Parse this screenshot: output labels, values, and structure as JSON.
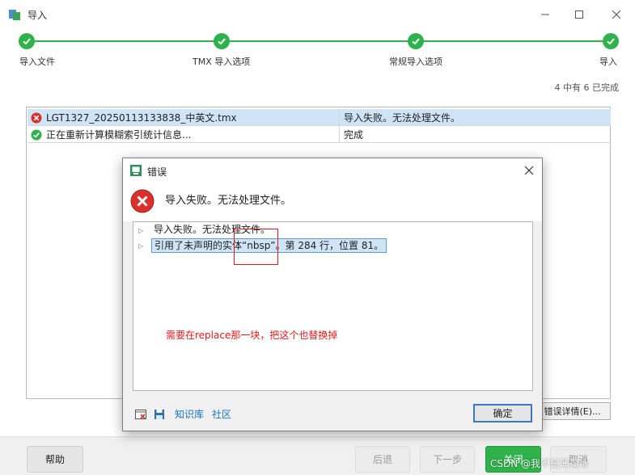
{
  "window": {
    "title": "导入",
    "icon": "app-import-icon",
    "controls": [
      "minimize-icon",
      "maximize-icon",
      "close-icon"
    ]
  },
  "steps": [
    {
      "label": "导入文件",
      "state": "complete"
    },
    {
      "label": "TMX 导入选项",
      "state": "complete"
    },
    {
      "label": "常规导入选项",
      "state": "complete"
    },
    {
      "label": "导入",
      "state": "complete"
    }
  ],
  "progress_text": "4 中有 6 已完成",
  "tasks": [
    {
      "name": "LGT1327_20250113133838_中英文.tmx",
      "status": "导入失败。无法处理文件。",
      "icon": "error-icon",
      "selected": true
    },
    {
      "name": "正在重新计算模糊索引统计信息...",
      "status": "完成",
      "icon": "check-icon",
      "selected": false
    }
  ],
  "error_details_label": "错误详情(E)...",
  "bottom_buttons": {
    "help": "帮助",
    "back": "后退",
    "next": "下一步",
    "close": "关闭",
    "cancel": "取消"
  },
  "dialog": {
    "title": "错误",
    "message": "导入失败。无法处理文件。",
    "tree": [
      {
        "text": "导入失败。无法处理文件。",
        "selected": false
      },
      {
        "text": "引用了未声明的实体“nbsp”。第 284 行，位置 81。",
        "selected": true
      }
    ],
    "annotation": "需要在replace那一块，把这个也替换掉",
    "links": {
      "knowledge_base": "知识库",
      "community": "社区"
    },
    "ok_label": "确定"
  },
  "watermark": "CSDN @我不是薄荷冰",
  "colors": {
    "accent_green": "#2fb14b",
    "selection": "#cfe4f7",
    "annotation_red": "#e41a1a",
    "link_blue": "#1a73c8"
  }
}
